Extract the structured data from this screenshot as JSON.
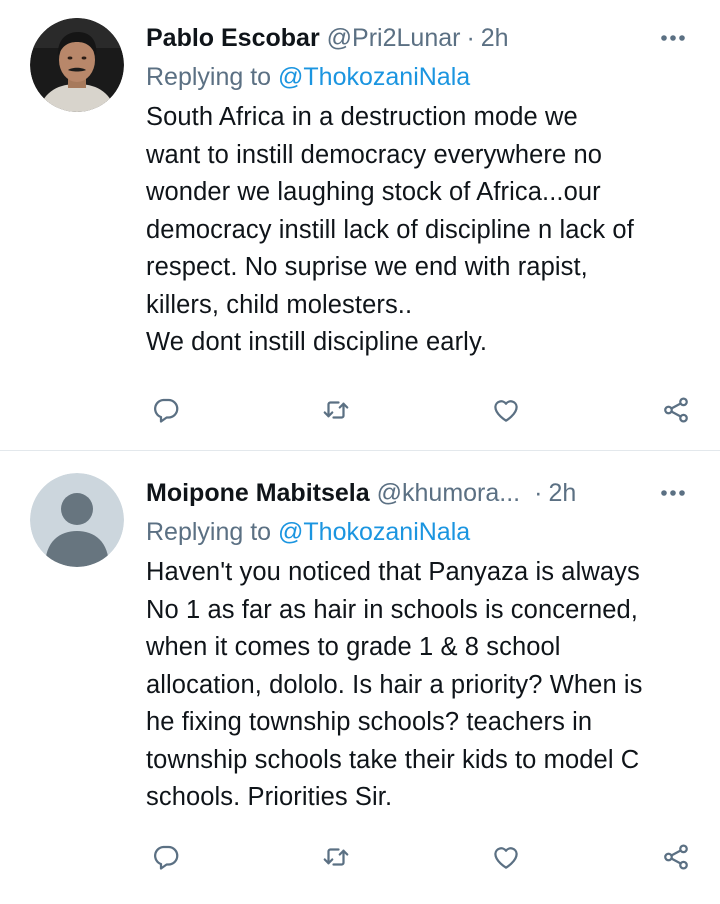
{
  "tweets": [
    {
      "display_name": "Pablo Escobar",
      "handle": "@Pri2Lunar",
      "separator": "·",
      "time": "2h",
      "replying_prefix": "Replying to",
      "replying_to": "@ThokozaniNala",
      "text": "South Africa in a destruction mode we\nwant to instill democracy everywhere no\nwonder we laughing stock of Africa...our\ndemocracy instill lack of discipline n lack of\nrespect. No suprise we end with rapist,\nkillers, child molesters..\nWe dont instill discipline early.",
      "avatar": "photo-avatar"
    },
    {
      "display_name": "Moipone Mabitsela",
      "handle": "@khumora...",
      "separator": "·",
      "time": "2h",
      "replying_prefix": "Replying to",
      "replying_to": "@ThokozaniNala",
      "text": "Haven't you noticed that Panyaza is always\nNo 1 as far as hair in schools is concerned,\nwhen it comes to grade 1 & 8 school\nallocation, dololo. Is hair a priority? When is\nhe fixing township schools? teachers in\ntownship schools take their kids to model C\nschools. Priorities Sir.",
      "avatar": "default-avatar"
    }
  ],
  "icons": {
    "more": "more-horizontal-icon",
    "reply": "reply-icon",
    "retweet": "retweet-icon",
    "like": "heart-icon",
    "share": "share-icon"
  },
  "colors": {
    "secondary_text": "#5b7083",
    "link": "#1b95e0",
    "primary_text": "#0f1419",
    "divider": "#e3e8ec"
  }
}
